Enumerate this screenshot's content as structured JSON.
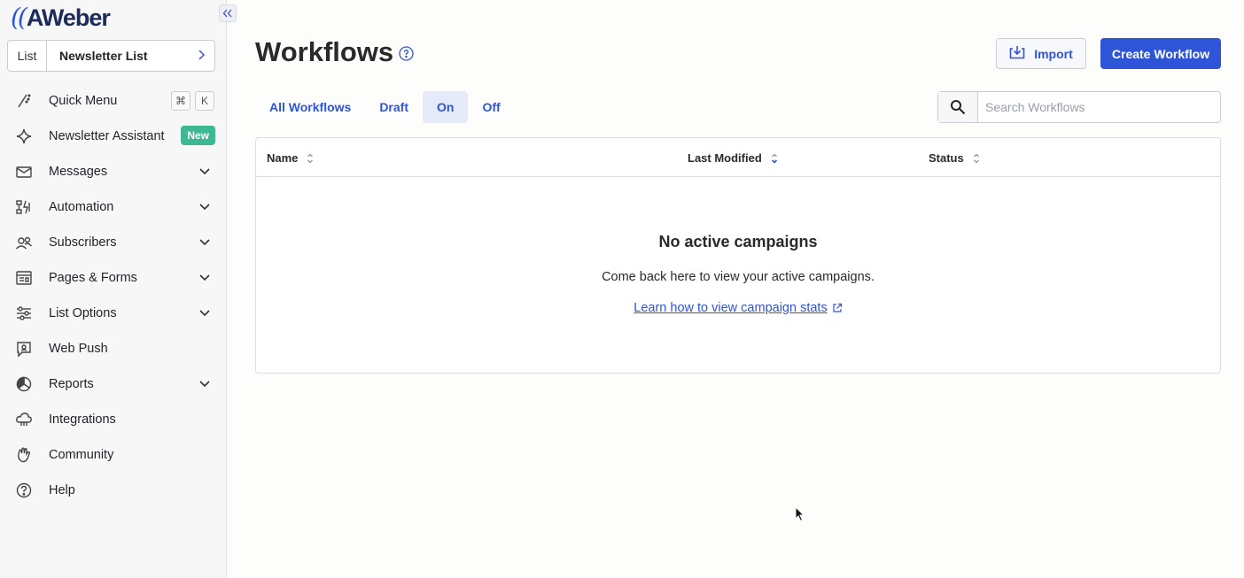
{
  "brand": {
    "logo_mark": "((",
    "logo_text": "AWeber"
  },
  "list_selector": {
    "label": "List",
    "value": "Newsletter List"
  },
  "sidebar": {
    "items": [
      {
        "label": "Quick Menu",
        "icon": "quick-menu-icon",
        "shortcut": [
          "⌘",
          "K"
        ]
      },
      {
        "label": "Newsletter Assistant",
        "icon": "sparkle-icon",
        "badge": "New"
      },
      {
        "label": "Messages",
        "icon": "envelope-icon",
        "expandable": true
      },
      {
        "label": "Automation",
        "icon": "automation-icon",
        "expandable": true
      },
      {
        "label": "Subscribers",
        "icon": "subscribers-icon",
        "expandable": true
      },
      {
        "label": "Pages & Forms",
        "icon": "pages-forms-icon",
        "expandable": true
      },
      {
        "label": "List Options",
        "icon": "sliders-icon",
        "expandable": true
      },
      {
        "label": "Web Push",
        "icon": "web-push-icon",
        "expandable": false
      },
      {
        "label": "Reports",
        "icon": "pie-chart-icon",
        "expandable": true
      },
      {
        "label": "Integrations",
        "icon": "cloud-icon",
        "expandable": false
      },
      {
        "label": "Community",
        "icon": "hand-wave-icon",
        "expandable": false
      },
      {
        "label": "Help",
        "icon": "help-icon",
        "expandable": false
      }
    ]
  },
  "header": {
    "title": "Workflows",
    "import_label": "Import",
    "create_label": "Create Workflow"
  },
  "tabs": [
    {
      "label": "All Workflows",
      "active": false
    },
    {
      "label": "Draft",
      "active": false
    },
    {
      "label": "On",
      "active": true
    },
    {
      "label": "Off",
      "active": false
    }
  ],
  "search": {
    "placeholder": "Search Workflows",
    "value": ""
  },
  "table": {
    "columns": [
      "Name",
      "Last Modified",
      "Status"
    ],
    "empty_title": "No active campaigns",
    "empty_text": "Come back here to view your active campaigns.",
    "empty_link": "Learn how to view campaign stats"
  },
  "colors": {
    "accent": "#2e55d8",
    "badge_new": "#3db892",
    "active_tab_bg": "#e4eaf7"
  }
}
